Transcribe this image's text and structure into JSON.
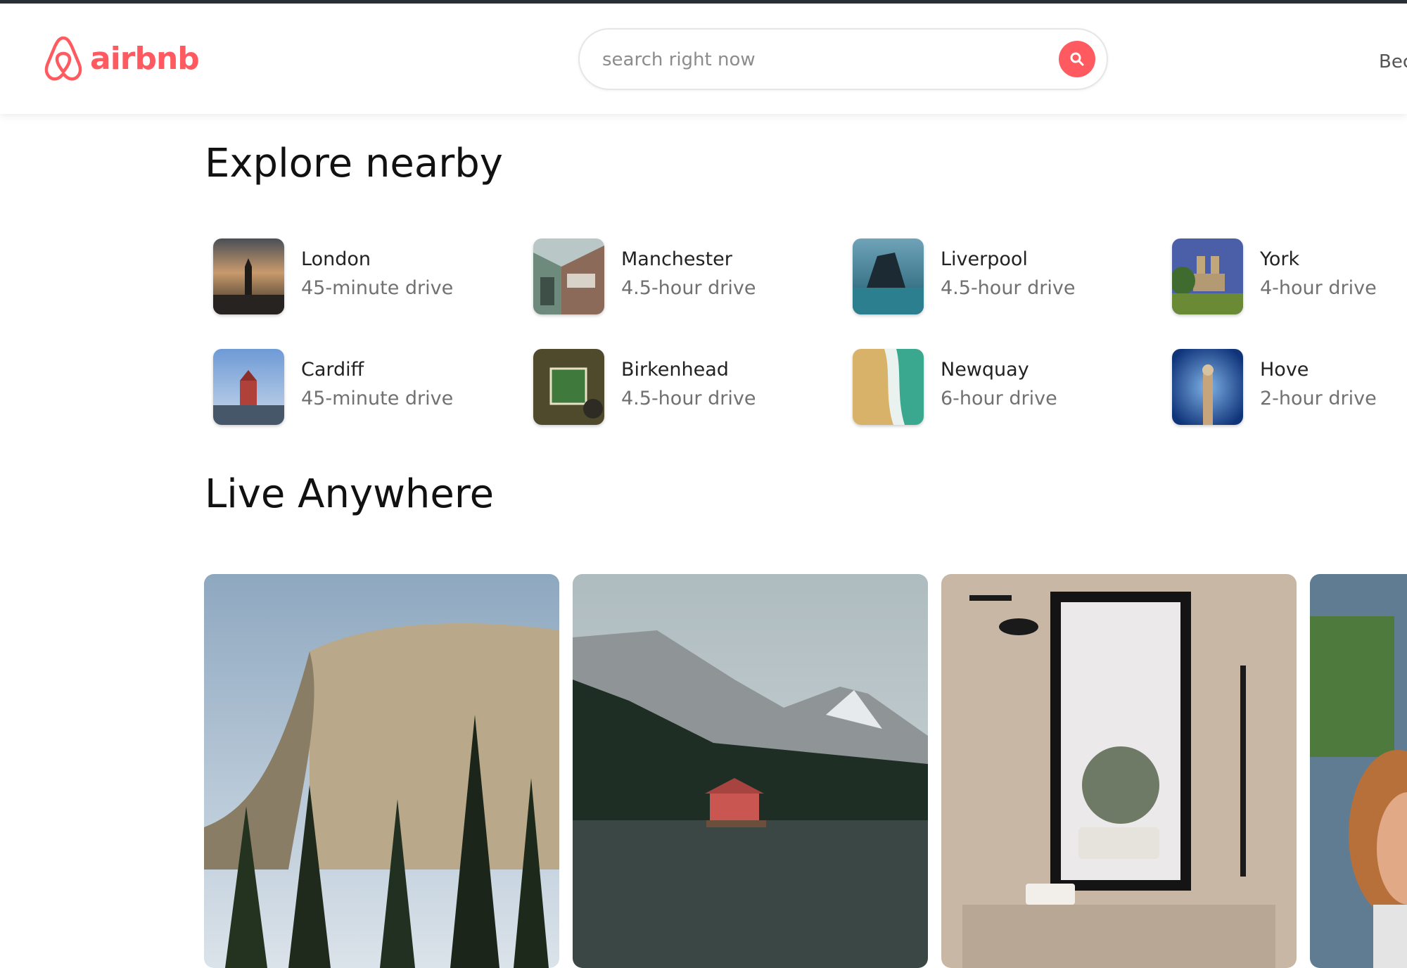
{
  "header": {
    "logo_text": "airbnb",
    "search_placeholder": "search right now",
    "nav_link": "Bec"
  },
  "explore": {
    "title": "Explore nearby",
    "places": [
      {
        "name": "London",
        "drive": "45-minute drive"
      },
      {
        "name": "Manchester",
        "drive": "4.5-hour drive"
      },
      {
        "name": "Liverpool",
        "drive": "4.5-hour drive"
      },
      {
        "name": "York",
        "drive": "4-hour drive"
      },
      {
        "name": "Cardiff",
        "drive": "45-minute drive"
      },
      {
        "name": "Birkenhead",
        "drive": "4.5-hour drive"
      },
      {
        "name": "Newquay",
        "drive": "6-hour drive"
      },
      {
        "name": "Hove",
        "drive": "2-hour drive"
      }
    ]
  },
  "live": {
    "title": "Live Anywhere"
  },
  "colors": {
    "brand": "#ff5a5f",
    "secondary_text": "#717171"
  }
}
